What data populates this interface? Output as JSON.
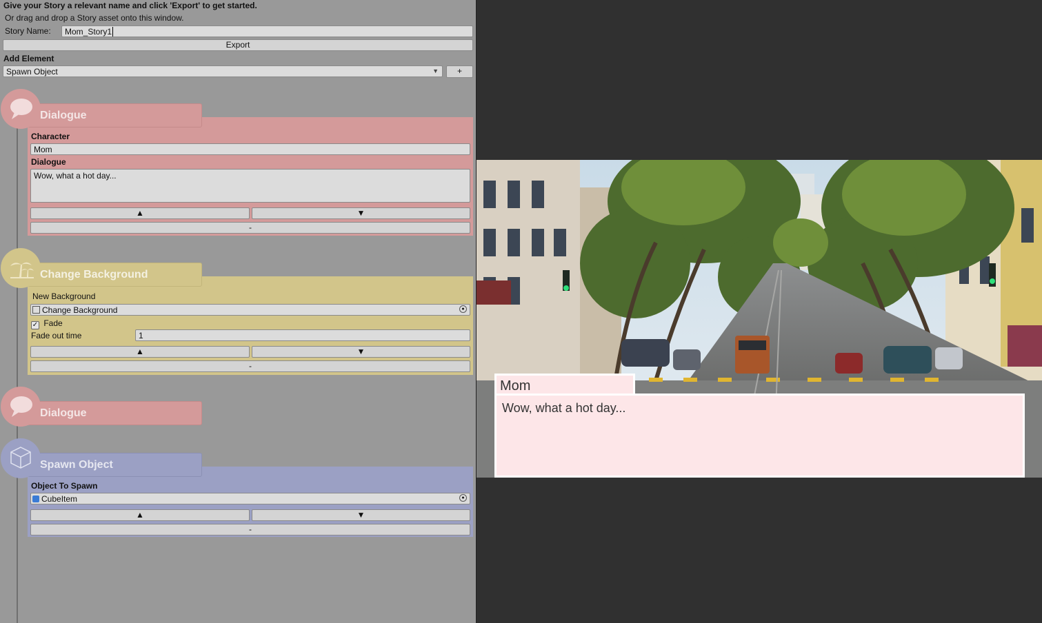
{
  "editor": {
    "intro_line1": "Give your Story a relevant name and click 'Export' to get started.",
    "intro_line2": "Or drag and drop a Story asset onto this window.",
    "story_name_label": "Story Name:",
    "story_name_value": "Mom_Story1",
    "export_label": "Export",
    "add_element_label": "Add Element",
    "add_element_selected": "Spawn Object",
    "add_button_label": "+",
    "move_up_glyph": "▲",
    "move_down_glyph": "▼",
    "remove_label": "-"
  },
  "elements": [
    {
      "title": "Dialogue",
      "color": "#d49a9a",
      "icon": "speech-bubble-icon",
      "character_label": "Character",
      "character_value": "Mom",
      "dialogue_label": "Dialogue",
      "dialogue_value": "Wow, what a hot day..."
    },
    {
      "title": "Change Background",
      "color": "#d2c58a",
      "icon": "palm-tree-icon",
      "new_background_label": "New Background",
      "new_background_value": "Change Background",
      "fade_label": "Fade",
      "fade_checked": true,
      "fade_time_label": "Fade out time",
      "fade_time_value": "1"
    },
    {
      "title": "Dialogue",
      "color": "#d49a9a",
      "icon": "speech-bubble-icon"
    },
    {
      "title": "Spawn Object",
      "color": "#9ba0c4",
      "icon": "cube-icon",
      "object_label": "Object To Spawn",
      "object_value": "CubeItem"
    }
  ],
  "game": {
    "speaker": "Mom",
    "dialogue": "Wow, what a hot day...",
    "dialogue_bg": "#fde6e8"
  }
}
